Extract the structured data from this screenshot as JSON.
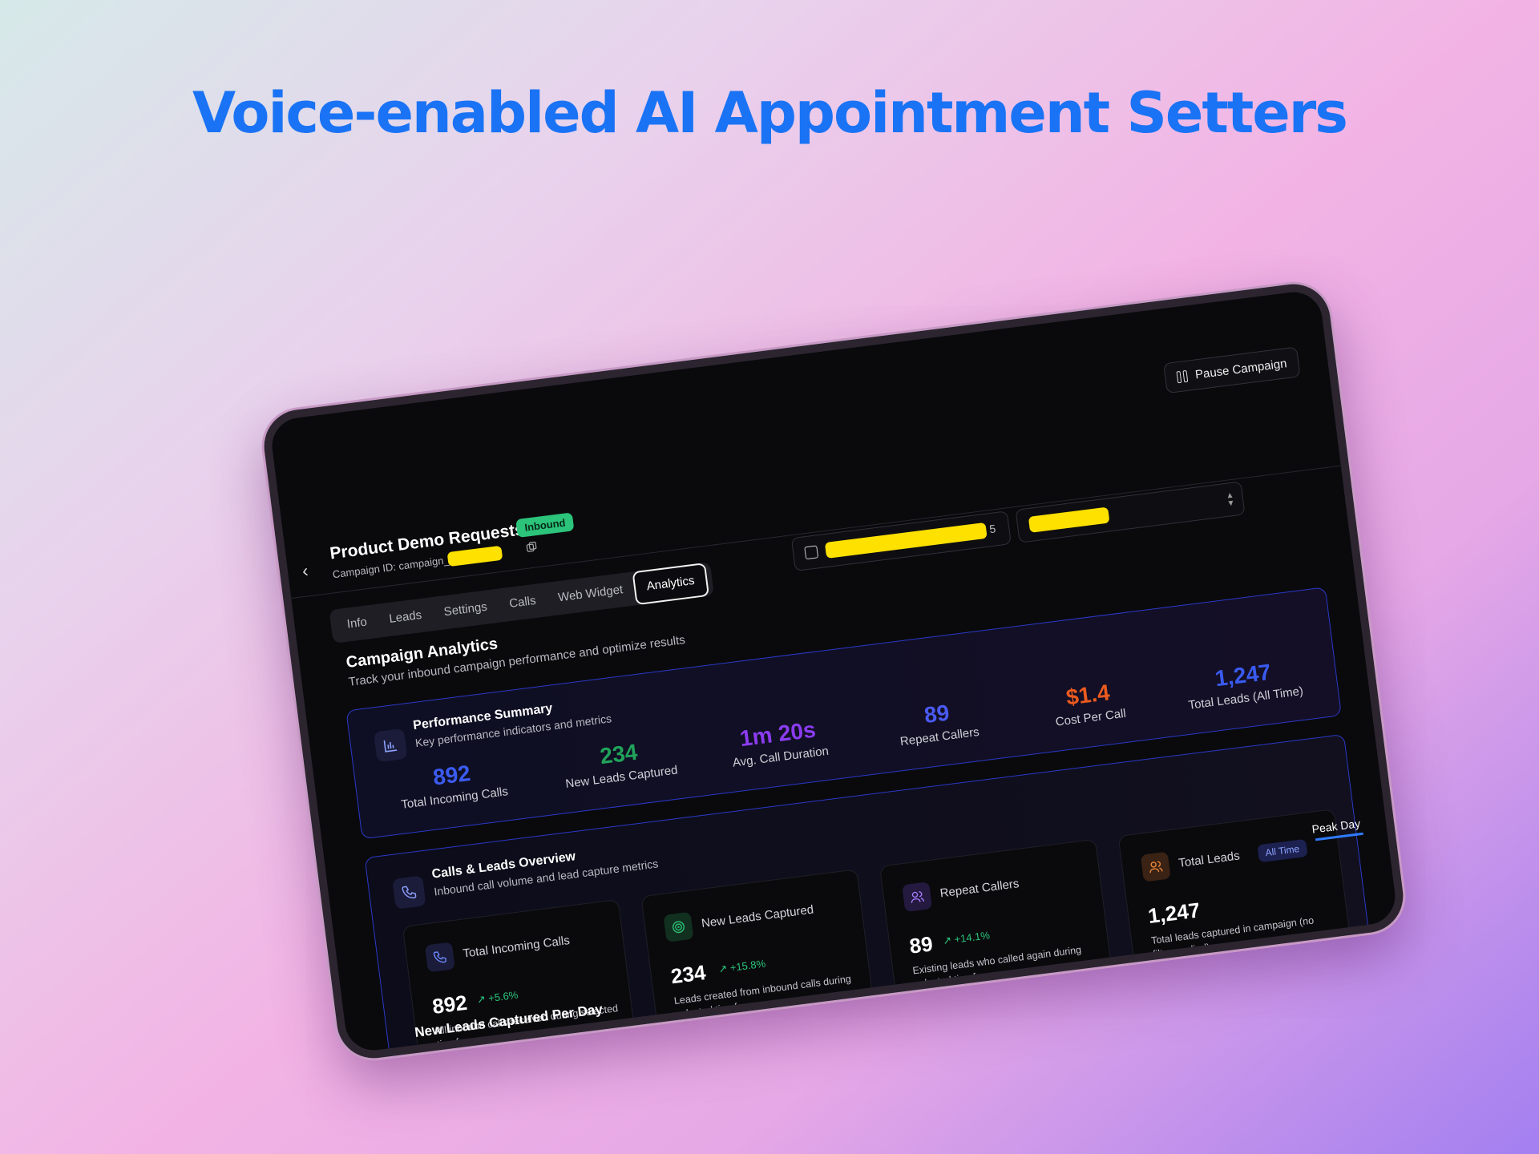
{
  "headline": "Voice-enabled AI Appointment Setters",
  "header": {
    "back": "‹",
    "title": "Product Demo Requests",
    "badge": "Inbound",
    "campaign_id_label": "Campaign ID: campaign_",
    "pause_label": "Pause Campaign"
  },
  "tabs": [
    "Info",
    "Leads",
    "Settings",
    "Calls",
    "Web Widget",
    "Analytics"
  ],
  "active_tab": "Analytics",
  "date_range": {
    "visible_text": "5"
  },
  "analytics": {
    "title": "Campaign Analytics",
    "subtitle": "Track your inbound campaign performance and optimize results"
  },
  "summary": {
    "title": "Performance Summary",
    "subtitle": "Key performance indicators and metrics",
    "metrics": [
      {
        "value": "892",
        "label": "Total Incoming Calls",
        "color": "#3b5bf0"
      },
      {
        "value": "234",
        "label": "New Leads Captured",
        "color": "#21a35a"
      },
      {
        "value": "1m 20s",
        "label": "Avg. Call Duration",
        "color": "#8b3cf0"
      },
      {
        "value": "89",
        "label": "Repeat Callers",
        "color": "#4a5af2"
      },
      {
        "value": "$1.4",
        "label": "Cost Per Call",
        "color": "#ea5a1e"
      },
      {
        "value": "1,247",
        "label": "Total Leads (All Time)",
        "color": "#3a5bf0"
      }
    ]
  },
  "overview": {
    "title": "Calls & Leads Overview",
    "subtitle": "Inbound call volume and lead capture metrics",
    "cards": [
      {
        "title": "Total Incoming Calls",
        "value": "892",
        "delta": "+5.6%",
        "desc": "All inbound calls received during selected timeframe",
        "icon": "phone-icon",
        "icon_color": "#6d8cff"
      },
      {
        "title": "New Leads Captured",
        "value": "234",
        "delta": "+15.8%",
        "desc": "Leads created from inbound calls during selected timeframe",
        "icon": "target-icon",
        "icon_color": "#2bc47a"
      },
      {
        "title": "Repeat Callers",
        "value": "89",
        "delta": "+14.1%",
        "desc": "Existing leads who called again during selected timeframe",
        "icon": "users-icon",
        "icon_color": "#a57cff"
      },
      {
        "title": "Total Leads",
        "value": "1,247",
        "badge": "All Time",
        "desc": "Total leads captured in campaign (no filter applied)",
        "icon": "users-icon",
        "icon_color": "#f08a3c"
      }
    ]
  },
  "peak_day": "Peak Day",
  "leads_per_day_title": "New Leads Captured Per Day"
}
